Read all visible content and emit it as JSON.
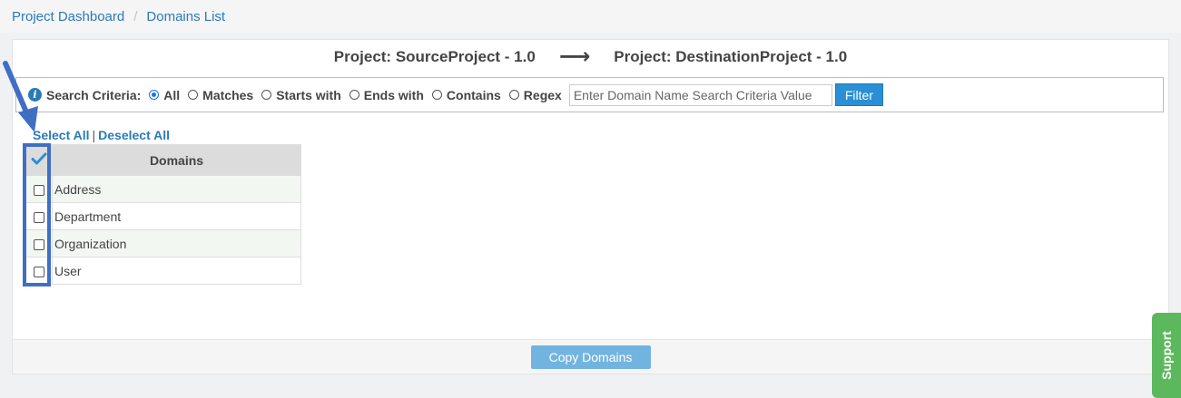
{
  "breadcrumb": {
    "items": [
      "Project Dashboard",
      "Domains List"
    ],
    "separator": "/"
  },
  "header": {
    "source": "Project: SourceProject - 1.0",
    "arrow": "⟶",
    "destination": "Project: DestinationProject - 1.0"
  },
  "search": {
    "label": "Search Criteria:",
    "options": [
      "All",
      "Matches",
      "Starts with",
      "Ends with",
      "Contains",
      "Regex"
    ],
    "selected": "All",
    "placeholder": "Enter Domain Name Search Criteria Value",
    "value": "",
    "filter_label": "Filter"
  },
  "selection": {
    "select_all": "Select All",
    "separator": "|",
    "deselect_all": "Deselect All"
  },
  "table": {
    "header": "Domains",
    "rows": [
      "Address",
      "Department",
      "Organization",
      "User"
    ]
  },
  "footer": {
    "copy_label": "Copy Domains"
  },
  "support": {
    "label": "Support"
  },
  "colors": {
    "link": "#2a7ab8",
    "accent": "#2a8fd4",
    "annotation": "#3f6ec4",
    "support": "#5cb85c"
  }
}
